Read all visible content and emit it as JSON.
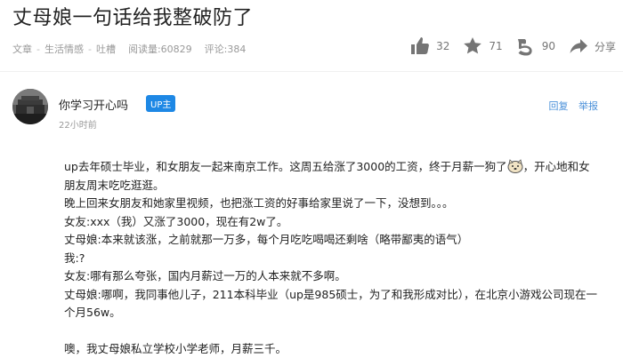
{
  "title": "丈母娘一句话给我整破防了",
  "meta": {
    "category": "文章",
    "subcategory": "生活情感",
    "tag": "吐槽",
    "views_label": "阅读量:60829",
    "comments_label": "评论:384"
  },
  "actions": {
    "like_count": "32",
    "favorite_count": "71",
    "coin_count": "90",
    "share_label": "分享"
  },
  "author": {
    "name": "你学习开心吗",
    "badge": "UP主",
    "time": "22小时前"
  },
  "reply_links": {
    "reply": "回复",
    "report": "举报"
  },
  "content": {
    "line1a": "up去年硕士毕业，和女朋友一起来南京工作。这周五给涨了3000的工资，终于月薪一狗了",
    "line1b": "，开心地和女朋友周末吃吃逛逛。",
    "line2": "晚上回来女朋友和她家里视频，也把涨工资的好事给家里说了一下，没想到。。。",
    "line3": "女友:xxx（我）又涨了3000，现在有2w了。",
    "line4": "丈母娘:本来就该涨，之前就那一万多，每个月吃吃喝喝还剩啥（略带鄙夷的语气）",
    "line5": "我:?",
    "line6": "女友:哪有那么夸张，国内月薪过一万的人本来就不多啊。",
    "line7": "丈母娘:哪啊，我同事他儿子，211本科毕业（up是985硕士，为了和我形成对比），在北京小游戏公司现在一个月56w。",
    "line8": "噢，我丈母娘私立学校小学老师，月薪三千。"
  },
  "icons": {
    "like": "thumbs-up-icon",
    "favorite": "star-icon",
    "coin": "coin-icon",
    "share": "share-arrow-icon",
    "emoji": "doge-emoji-icon"
  }
}
